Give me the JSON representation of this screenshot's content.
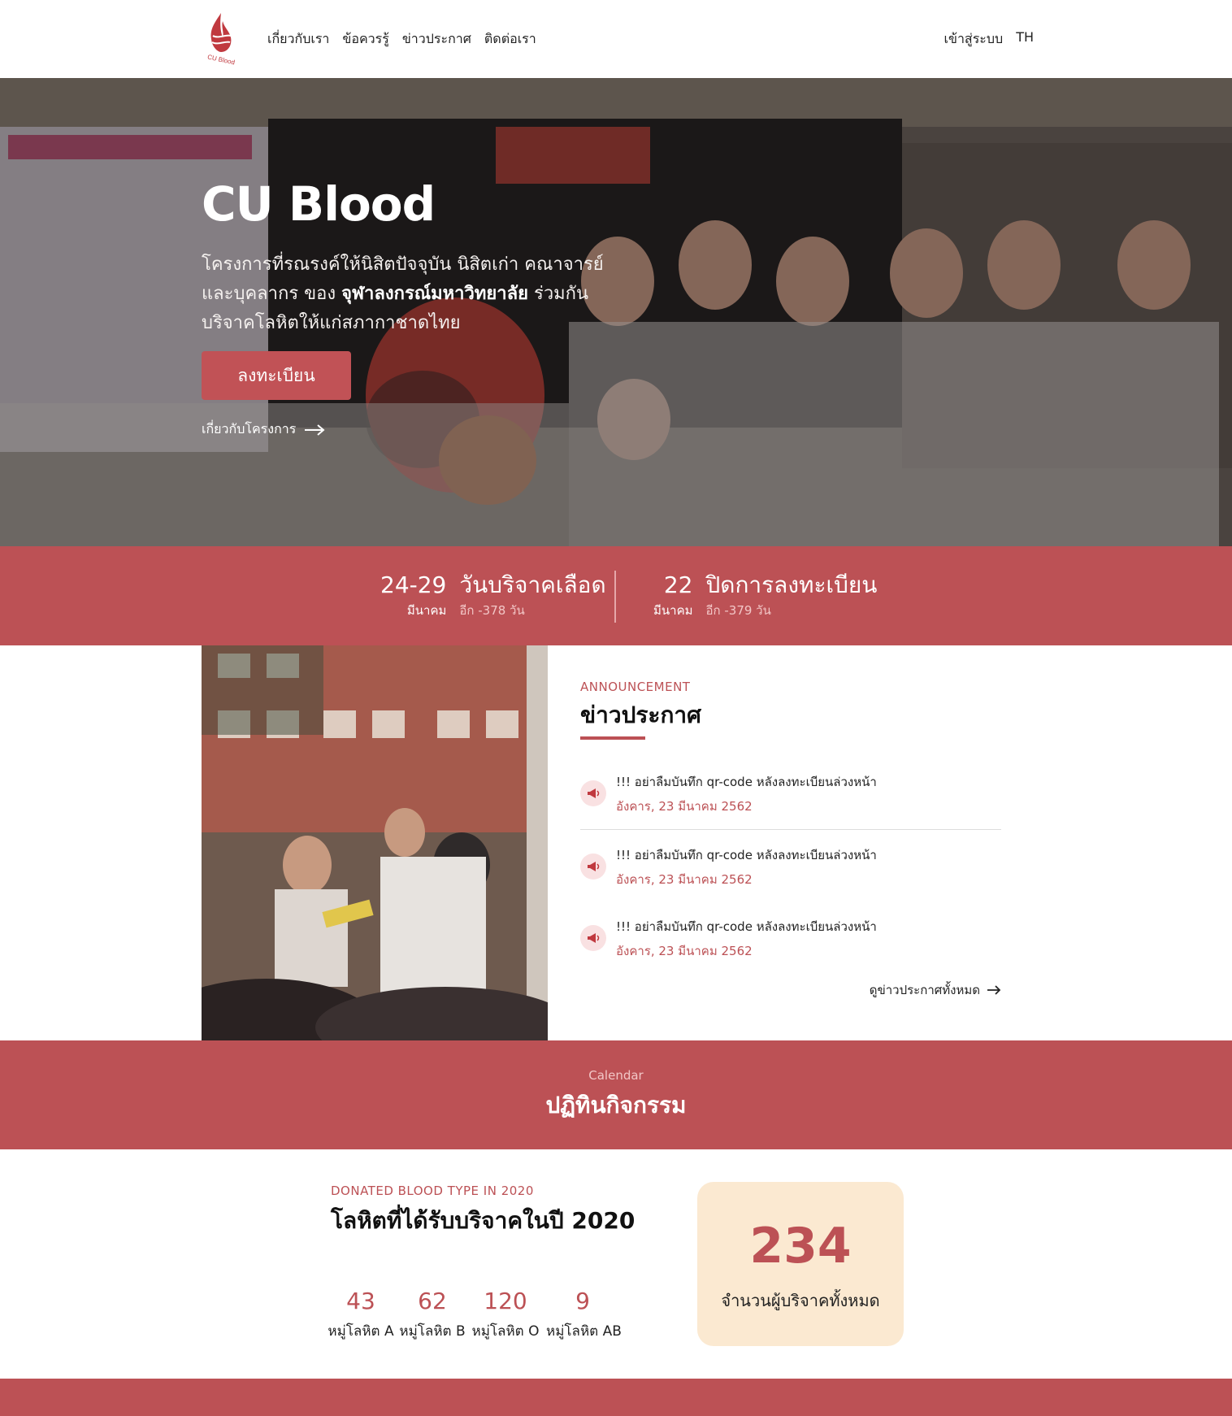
{
  "header": {
    "nav": [
      "เกี่ยวกับเรา",
      "ข้อควรรู้",
      "ข่าวประกาศ",
      "ติดต่อเรา"
    ],
    "login": "เข้าสู่ระบบ",
    "language": "TH"
  },
  "hero": {
    "title": "CU Blood",
    "desc_part1": "โครงการที่รณรงค์ให้นิสิตปัจจุบัน นิสิตเก่า คณาจารย์ และบุคลากร ของ ",
    "desc_bold": "จุฬาลงกรณ์มหาวิทยาลัย",
    "desc_part2": " ร่วมกันบริจาคโลหิตให้แก่สภากาชาดไทย",
    "register_label": "ลงทะเบียน",
    "about_link": "เกี่ยวกับโครงการ"
  },
  "dates": {
    "donation": {
      "days": "24-29",
      "month": "มีนาคม",
      "label": "วันบริจาคเลือด",
      "countdown": "อีก -378 วัน"
    },
    "close": {
      "days": "22",
      "month": "มีนาคม",
      "label": "ปิดการลงทะเบียน",
      "countdown": "อีก -379 วัน"
    }
  },
  "announcement": {
    "kicker": "ANNOUNCEMENT",
    "title": "ข่าวประกาศ",
    "items": [
      {
        "text": "!!! อย่าลืมบันทึก qr-code หลังลงทะเบียนล่วงหน้า",
        "date": "อังคาร, 23 มีนาคม 2562"
      },
      {
        "text": "!!! อย่าลืมบันทึก qr-code หลังลงทะเบียนล่วงหน้า",
        "date": "อังคาร, 23 มีนาคม 2562"
      },
      {
        "text": "!!! อย่าลืมบันทึก qr-code หลังลงทะเบียนล่วงหน้า",
        "date": "อังคาร, 23 มีนาคม 2562"
      }
    ],
    "view_all": "ดูข่าวประกาศทั้งหมด"
  },
  "calendar": {
    "kicker": "Calendar",
    "title": "ปฏิทินกิจกรรม"
  },
  "stats": {
    "kicker": "DONATED BLOOD TYPE IN 2020",
    "title": "โลหิตที่ได้รับบริจาคในปี 2020",
    "types": [
      {
        "count": "43",
        "label": "หมู่โลหิต A"
      },
      {
        "count": "62",
        "label": "หมู่โลหิต B"
      },
      {
        "count": "120",
        "label": "หมู่โลหิต O"
      },
      {
        "count": "9",
        "label": "หมู่โลหิต AB"
      }
    ],
    "total": "234",
    "total_label": "จำนวนผู้บริจาคทั้งหมด"
  },
  "colors": {
    "brand": "#bc5155",
    "card_bg": "#fbe9d1"
  },
  "icons": {
    "logo": "cu-blood-flame-logo",
    "arrow": "arrow-right-icon",
    "announcement": "megaphone-icon"
  }
}
